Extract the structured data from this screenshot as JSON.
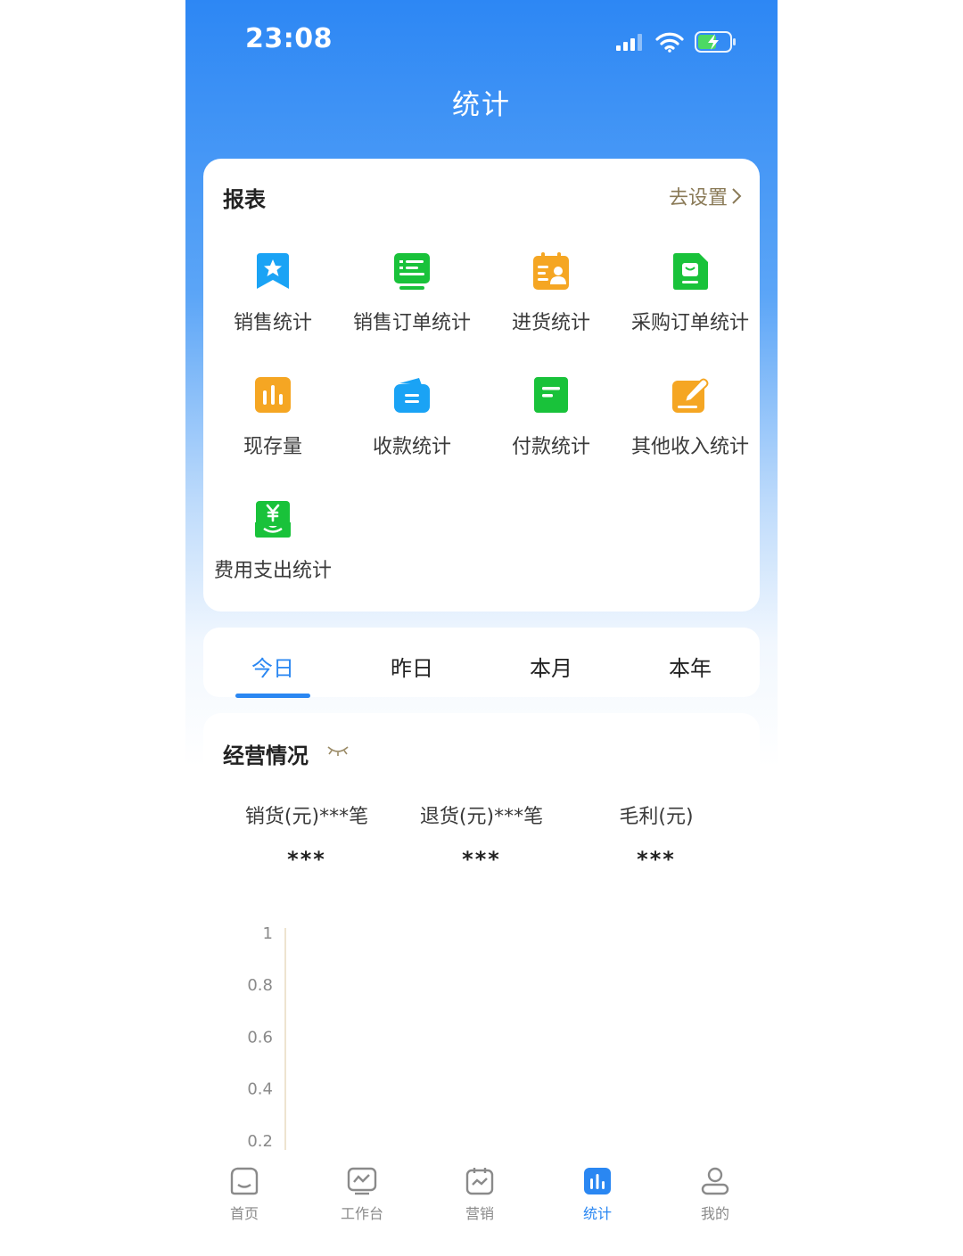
{
  "status_bar": {
    "time": "23:08"
  },
  "nav": {
    "title": "统计"
  },
  "report": {
    "title": "报表",
    "settings_link": "去设置",
    "items": [
      {
        "label": "销售统计",
        "icon": "sales-star-icon",
        "color": "#1aa3f5"
      },
      {
        "label": "销售订单统计",
        "icon": "sales-order-icon",
        "color": "#19c23a"
      },
      {
        "label": "进货统计",
        "icon": "purchase-icon",
        "color": "#f5a623"
      },
      {
        "label": "采购订单统计",
        "icon": "purchase-order-icon",
        "color": "#19c23a"
      },
      {
        "label": "现存量",
        "icon": "stock-chart-icon",
        "color": "#f5a623"
      },
      {
        "label": "收款统计",
        "icon": "receipt-wallet-icon",
        "color": "#1aa3f5"
      },
      {
        "label": "付款统计",
        "icon": "payment-doc-icon",
        "color": "#19c23a"
      },
      {
        "label": "其他收入统计",
        "icon": "edit-income-icon",
        "color": "#f5a623"
      },
      {
        "label": "费用支出统计",
        "icon": "expense-yen-icon",
        "color": "#19c23a"
      }
    ]
  },
  "period_tabs": {
    "items": [
      "今日",
      "昨日",
      "本月",
      "本年"
    ],
    "active": "今日"
  },
  "business": {
    "title": "经营情况",
    "metrics": [
      {
        "label": "销货(元)***笔",
        "value": "***"
      },
      {
        "label": "退货(元)***笔",
        "value": "***"
      },
      {
        "label": "毛利(元)",
        "value": "***"
      }
    ]
  },
  "chart_data": {
    "type": "line",
    "y_ticks": [
      "1",
      "0.8",
      "0.6",
      "0.4",
      "0.2"
    ],
    "ylim": [
      0,
      1
    ],
    "series": []
  },
  "tabbar": {
    "items": [
      {
        "label": "首页",
        "icon": "home-icon"
      },
      {
        "label": "工作台",
        "icon": "workbench-icon"
      },
      {
        "label": "营销",
        "icon": "marketing-icon"
      },
      {
        "label": "统计",
        "icon": "stats-icon"
      },
      {
        "label": "我的",
        "icon": "profile-icon"
      }
    ],
    "active": "统计",
    "active_color": "#2a87f2",
    "inactive_color": "#8a8a8a"
  }
}
